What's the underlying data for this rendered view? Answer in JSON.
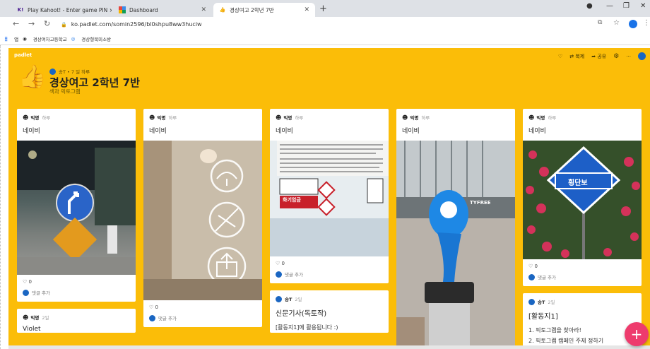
{
  "browser": {
    "tabs": [
      {
        "label": "Play Kahoot! - Enter game PIN ×",
        "icon": "kahoot-icon"
      },
      {
        "label": "Dashboard",
        "icon": "dashboard-icon"
      },
      {
        "label": "경상여고 2학년 7반",
        "icon": "thumbs-up-icon"
      }
    ],
    "url": "ko.padlet.com/somin2596/bl0shpu8ww3huciw",
    "bookmarks": [
      "앱",
      "경상여자고등학교",
      "경상형북미소방"
    ]
  },
  "board": {
    "logo": "padlet",
    "author_line": "송T • 7 일 하루",
    "title": "경상여고 2학년 7반",
    "description": "색과 픽토그램",
    "toolbar": {
      "remake": "복제",
      "share": "공유"
    },
    "background_color": "#fbbd08"
  },
  "columns": [
    {
      "cards": [
        {
          "author": "익명",
          "time": "하루",
          "title": "네이비",
          "likes": "0",
          "comment": "댓글 추가",
          "image": "street-sign"
        },
        {
          "author": "익명",
          "time": "2일",
          "title": "Violet"
        }
      ]
    },
    {
      "cards": [
        {
          "author": "익명",
          "time": "하루",
          "title": "네이비",
          "likes": "0",
          "comment": "댓글 추가",
          "image": "tag-icons"
        }
      ]
    },
    {
      "cards": [
        {
          "author": "익명",
          "time": "하루",
          "title": "네이비",
          "likes": "0",
          "comment": "댓글 추가",
          "image": "bottle-label",
          "label_text": "화기엄금"
        },
        {
          "author": "송T",
          "time": "2일",
          "title": "신문기사(독토작)",
          "body": "[활동지1]에 활용됩니다 :)"
        }
      ]
    },
    {
      "cards": [
        {
          "author": "익명",
          "time": "하루",
          "title": "네이비",
          "image": "mascot-statue",
          "sign_text": "TYFREE"
        }
      ]
    },
    {
      "cards": [
        {
          "author": "익명",
          "time": "하루",
          "title": "네이비",
          "likes": "0",
          "comment": "댓글 추가",
          "image": "flowers-sign",
          "sign_text": "횡단보"
        },
        {
          "author": "송T",
          "time": "2일",
          "title": "[활동지1]",
          "body": "1. 픽토그램을 찾아라!",
          "body2": "2. 픽토그램 캠페인 주제 정하기"
        }
      ]
    }
  ]
}
